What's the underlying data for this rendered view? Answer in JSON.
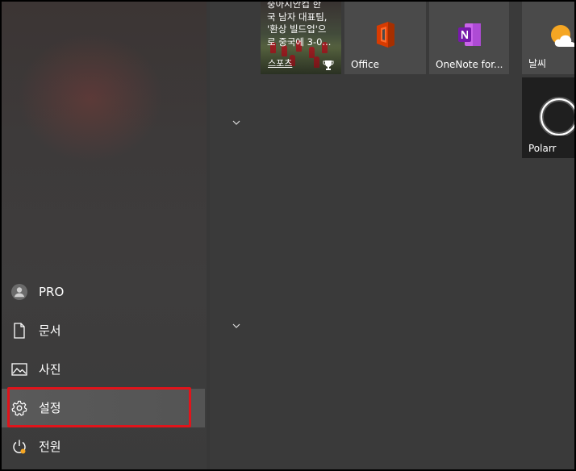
{
  "rail": {
    "items": [
      {
        "id": "user",
        "label": "PRO",
        "icon": "user-avatar-icon"
      },
      {
        "id": "documents",
        "label": "문서",
        "icon": "document-icon"
      },
      {
        "id": "pictures",
        "label": "사진",
        "icon": "picture-icon"
      },
      {
        "id": "settings",
        "label": "설정",
        "icon": "gear-icon",
        "active": true
      },
      {
        "id": "power",
        "label": "전원",
        "icon": "power-icon"
      }
    ]
  },
  "tiles": {
    "news": {
      "headline_lines": [
        "중아시안컵 한",
        "국 남자 대표팀,",
        "'환상 빌드업'으",
        "로 중국에 3-0..."
      ],
      "category": "스포츠",
      "icon": "trophy-icon"
    },
    "office": {
      "label": "Office",
      "icon": "office-logo-icon"
    },
    "onenote": {
      "label": "OneNote for...",
      "icon": "onenote-logo-icon"
    },
    "weather": {
      "label": "날씨",
      "icon": "weather-sun-cloud-icon"
    },
    "polarr": {
      "label": "Polarr",
      "icon": "polarr-ring-icon"
    }
  },
  "group_chevrons": [
    "chevron-down-icon",
    "chevron-down-icon"
  ],
  "colors": {
    "highlight": "#e0141b",
    "office_red": "#d83b01",
    "onenote_purple": "#7719aa",
    "weather_sun": "#f5a623"
  }
}
